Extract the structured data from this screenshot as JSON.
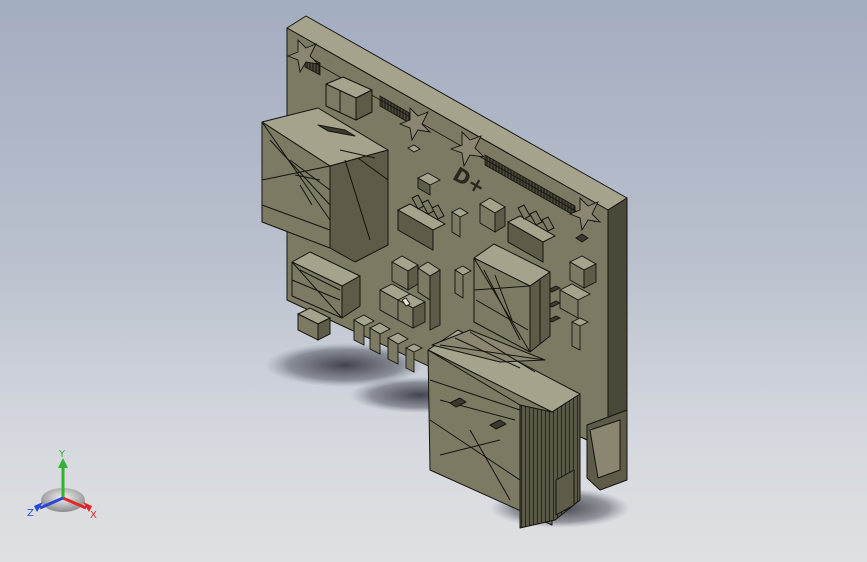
{
  "viewport": {
    "background_top": "#a3adc0",
    "background_bottom": "#dfe0e3"
  },
  "model": {
    "body_color": "#67644f",
    "face_color": "#8a8671",
    "dark_color": "#3d3b2f",
    "edge_color": "#141410",
    "silkscreen_text": "D+"
  },
  "triad": {
    "x_label": "X",
    "y_label": "Y",
    "z_label": "Z",
    "x_color": "#e0282a",
    "y_color": "#2fb531",
    "z_color": "#2c47d6"
  }
}
